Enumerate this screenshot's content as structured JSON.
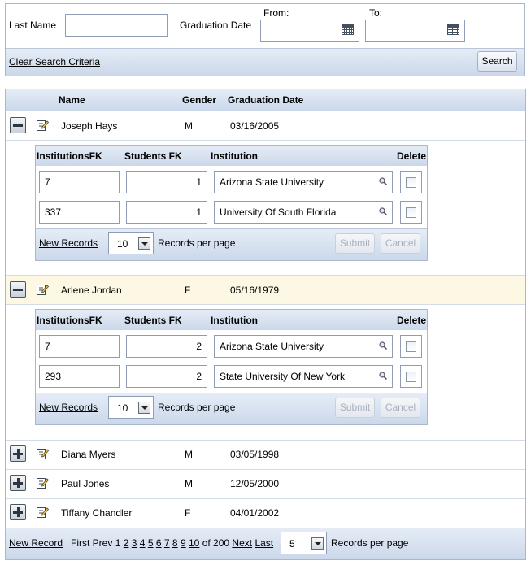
{
  "search": {
    "last_name_label": "Last Name",
    "last_name_value": "",
    "graduation_date_label": "Graduation Date",
    "from_label": "From:",
    "to_label": "To:",
    "from_value": "",
    "to_value": "",
    "clear_label": "Clear Search Criteria",
    "search_label": "Search"
  },
  "grid": {
    "headers": {
      "name": "Name",
      "gender": "Gender",
      "graduation_date": "Graduation Date"
    },
    "rows": [
      {
        "name": "Joseph Hays",
        "gender": "M",
        "date": "03/16/2005",
        "expanded": true
      },
      {
        "name": "Arlene Jordan",
        "gender": "F",
        "date": "05/16/1979",
        "expanded": true
      },
      {
        "name": "Diana Myers",
        "gender": "M",
        "date": "03/05/1998",
        "expanded": false
      },
      {
        "name": "Paul Jones",
        "gender": "M",
        "date": "12/05/2000",
        "expanded": false
      },
      {
        "name": "Tiffany Chandler",
        "gender": "F",
        "date": "04/01/2002",
        "expanded": false
      }
    ],
    "sub_headers": {
      "institutions_fk": "InstitutionsFK",
      "students_fk": "Students FK",
      "institution": "Institution",
      "delete": "Delete"
    },
    "subgrids": [
      {
        "rows": [
          {
            "institutions_fk": "7",
            "students_fk": "1",
            "institution": "Arizona State University"
          },
          {
            "institutions_fk": "337",
            "students_fk": "1",
            "institution": "University Of South Florida"
          }
        ],
        "new_records": "New Records",
        "page_size": "10",
        "records_per_page": "Records per page",
        "submit": "Submit",
        "cancel": "Cancel"
      },
      {
        "rows": [
          {
            "institutions_fk": "7",
            "students_fk": "2",
            "institution": "Arizona State University"
          },
          {
            "institutions_fk": "293",
            "students_fk": "2",
            "institution": "State University Of New York"
          }
        ],
        "new_records": "New Records",
        "page_size": "10",
        "records_per_page": "Records per page",
        "submit": "Submit",
        "cancel": "Cancel"
      }
    ],
    "footer": {
      "new_record": "New Record",
      "first": "First",
      "prev": "Prev",
      "current_page": "1",
      "pages": [
        "2",
        "3",
        "4",
        "5",
        "6",
        "7",
        "8",
        "9",
        "10"
      ],
      "of_total": "of 200",
      "next": "Next",
      "last": "Last",
      "page_size": "5",
      "records_per_page": "Records per page"
    }
  },
  "colors": {
    "header_bar": "#cbd8ea",
    "highlight_row": "#fdf8e4",
    "border": "#a9b8cc"
  },
  "icons": {
    "toggle_collapse": "minus-icon",
    "toggle_expand": "plus-icon",
    "edit": "edit-icon",
    "calendar": "calendar-icon",
    "lookup": "search-icon"
  }
}
